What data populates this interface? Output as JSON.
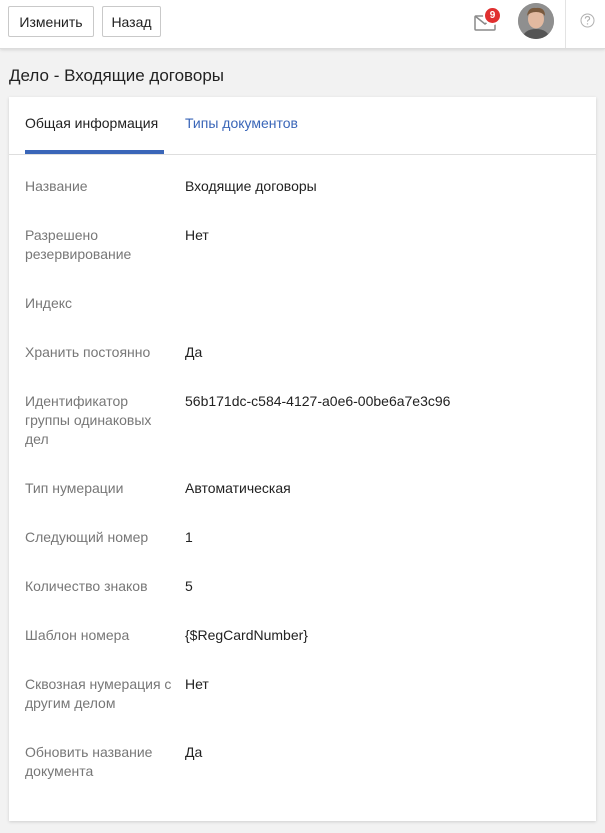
{
  "toolbar": {
    "edit_label": "Изменить",
    "back_label": "Назад",
    "notifications_count": "9"
  },
  "page": {
    "title": "Дело - Входящие договоры"
  },
  "tabs": [
    {
      "label": "Общая информация",
      "active": true
    },
    {
      "label": "Типы документов",
      "active": false
    }
  ],
  "fields": [
    {
      "label": "Название",
      "value": "Входящие договоры"
    },
    {
      "label": "Разрешено резервирование",
      "value": "Нет"
    },
    {
      "label": "Индекс",
      "value": ""
    },
    {
      "label": "Хранить постоянно",
      "value": "Да"
    },
    {
      "label": "Идентификатор группы одинаковых дел",
      "value": "56b171dc-c584-4127-a0e6-00be6a7e3c96"
    },
    {
      "label": "Тип нумерации",
      "value": "Автоматическая"
    },
    {
      "label": "Следующий номер",
      "value": "1"
    },
    {
      "label": "Количество знаков",
      "value": "5"
    },
    {
      "label": "Шаблон номера",
      "value": "{$RegCardNumber}"
    },
    {
      "label": "Сквозная нумерация с другим делом",
      "value": "Нет"
    },
    {
      "label": "Обновить название документа",
      "value": "Да"
    }
  ],
  "colors": {
    "accent": "#3a66b8",
    "badge": "#e03030",
    "label_text": "#777777"
  },
  "icons": {
    "mail": "mail-icon",
    "help": "help-icon",
    "avatar": "user-avatar"
  }
}
